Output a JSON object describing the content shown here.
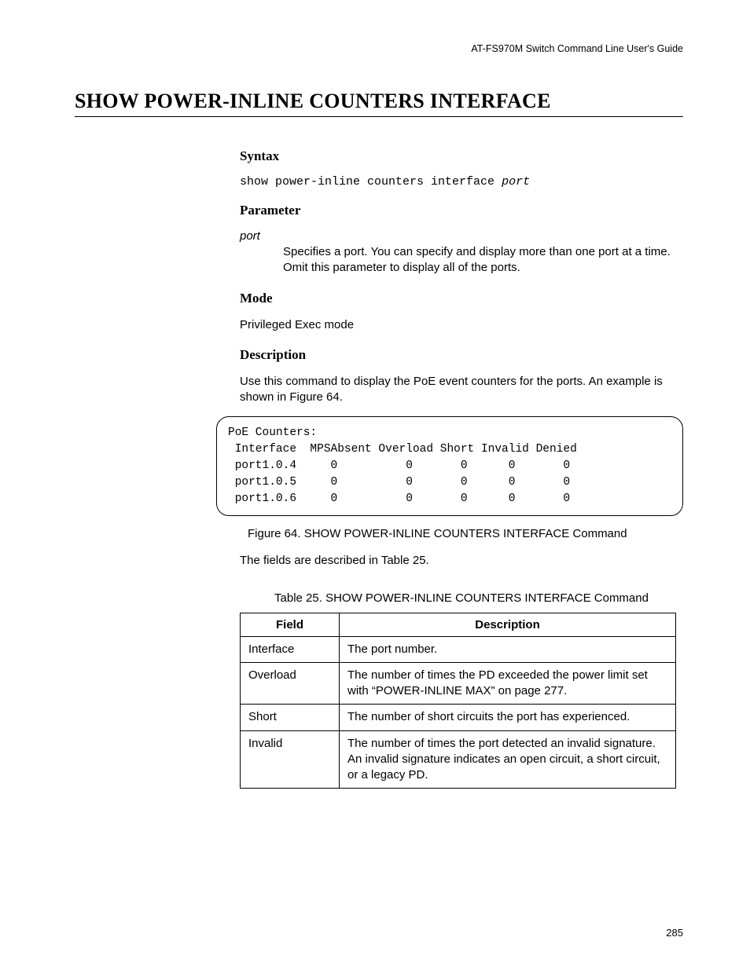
{
  "header": {
    "guide_title": "AT-FS970M Switch Command Line User's Guide"
  },
  "title": "SHOW POWER-INLINE COUNTERS INTERFACE",
  "syntax": {
    "heading": "Syntax",
    "command": "show power-inline counters interface ",
    "arg": "port"
  },
  "parameter": {
    "heading": "Parameter",
    "name": "port",
    "desc": "Specifies a port. You can specify and display more than one port at a time. Omit this parameter to display all of the ports."
  },
  "mode": {
    "heading": "Mode",
    "text": "Privileged Exec mode"
  },
  "description": {
    "heading": "Description",
    "text": "Use this command to display the PoE event counters for the ports. An example is shown in Figure 64."
  },
  "figure": {
    "title_line": "PoE Counters:",
    "header_line": " Interface  MPSAbsent Overload Short Invalid Denied",
    "rows": [
      " port1.0.4     0          0       0      0       0",
      " port1.0.5     0          0       0      0       0",
      " port1.0.6     0          0       0      0       0"
    ],
    "caption": "Figure 64. SHOW POWER-INLINE COUNTERS INTERFACE Command"
  },
  "after_figure_text": "The fields are described in Table 25.",
  "table": {
    "caption": "Table 25. SHOW POWER-INLINE COUNTERS INTERFACE Command",
    "head_field": "Field",
    "head_desc": "Description",
    "rows": [
      {
        "field": "Interface",
        "desc": "The port number."
      },
      {
        "field": "Overload",
        "desc": "The number of times the PD exceeded the power limit set with “POWER-INLINE MAX” on page 277."
      },
      {
        "field": "Short",
        "desc": "The number of short circuits the port has experienced."
      },
      {
        "field": "Invalid",
        "desc": "The number of times the port detected an invalid signature. An invalid signature indicates an open circuit, a short circuit, or a legacy PD."
      }
    ]
  },
  "page_number": "285"
}
